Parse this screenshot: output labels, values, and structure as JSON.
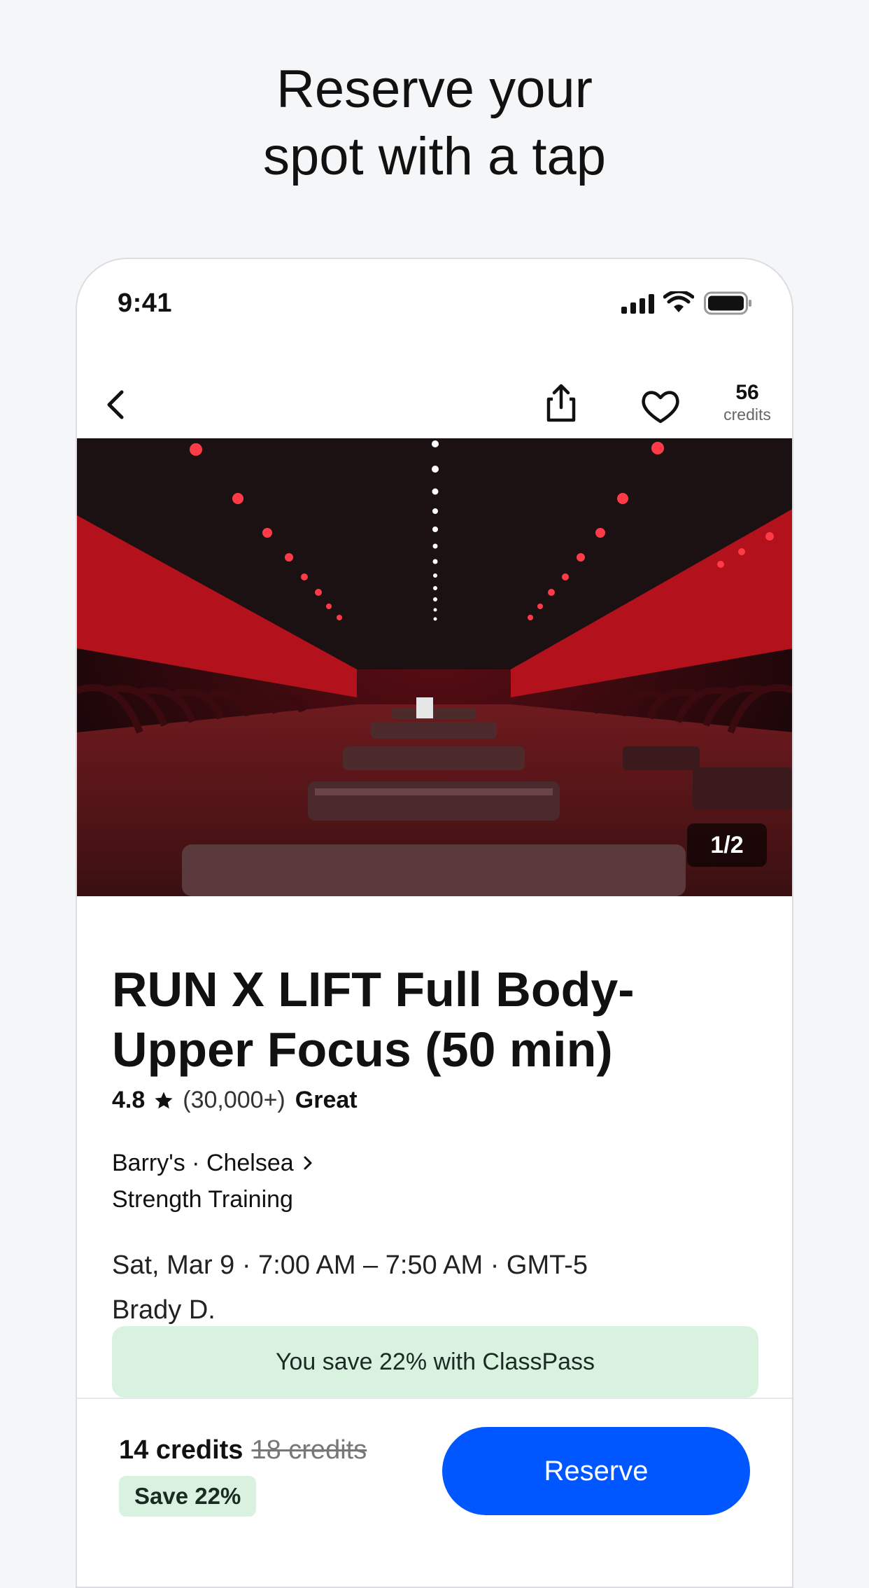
{
  "headline": {
    "line1": "Reserve your",
    "line2": "spot with a tap"
  },
  "status_bar": {
    "time": "9:41",
    "battery_level": 1.0
  },
  "navbar": {
    "credits_count": "56",
    "credits_label": "credits"
  },
  "hero": {
    "pager": "1/2",
    "image": "red-lit-gym-studio-photo"
  },
  "class": {
    "title_line1": "RUN X LIFT Full Body-",
    "title_line2": "Upper Focus (50 min)",
    "rating": "4.8",
    "reviews": "(30,000+)",
    "quality": "Great",
    "venue": "Barry's · Chelsea",
    "category": "Strength Training",
    "schedule": "Sat, Mar 9 · 7:00 AM – 7:50 AM · GMT-5",
    "instructor": "Brady D."
  },
  "savings_banner": "You save 22% with ClassPass",
  "booking": {
    "price_now": "14 credits",
    "price_was": "18 credits",
    "save_badge": "Save 22%",
    "reserve_label": "Reserve"
  },
  "colors": {
    "accent": "#0057ff",
    "savings_bg": "#d9f2e0",
    "page_bg": "#f5f6f8"
  }
}
